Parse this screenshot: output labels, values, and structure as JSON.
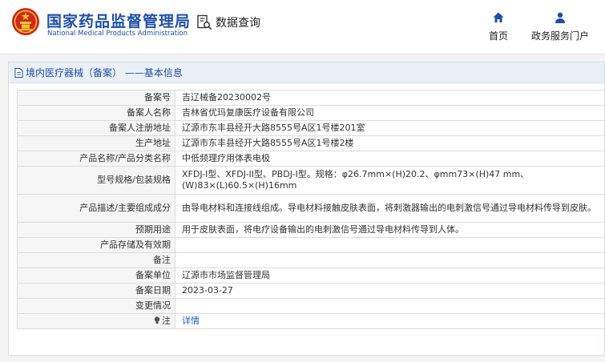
{
  "header": {
    "brand_cn": "国家药品监督管理局",
    "brand_en": "National Medical Products Administration",
    "query_label": "数据查询",
    "nav": [
      {
        "label": "首页",
        "icon": "home-icon"
      },
      {
        "label": "政务服务门户",
        "icon": "user-icon"
      }
    ]
  },
  "panel": {
    "title": "境内医疗器械（备案） ——基本信息"
  },
  "rows": [
    {
      "key": "备案号",
      "value": "吉辽械备20230002号"
    },
    {
      "key": "备案人名称",
      "value": "吉林省优玛复康医疗设备有限公司"
    },
    {
      "key": "备案人注册地址",
      "value": "辽源市东丰县经开大路8555号A区1号楼201室"
    },
    {
      "key": "生产地址",
      "value": "辽源市东丰县经开大路8555号A区1号楼2楼"
    },
    {
      "key": "产品名称/产品分类名称",
      "value": "中低频理疗用体表电极"
    },
    {
      "key": "型号规格/包装规格",
      "value": "XFDJ-I型、XFDJ-II型、PBDJ-I型。规格：φ26.7mm×(H)20.2、φmm73×(H)47 mm、(W)83×(L)60.5×(H)16mm"
    },
    {
      "key": "产品描述/主要组成成分",
      "value": "由导电材料和连接线组成。导电材料接触皮肤表面，将刺激器输出的电刺激信号通过导电材料传导到皮肤。"
    },
    {
      "key": "预期用途",
      "value": "用于皮肤表面，将电疗设备输出的电刺激信号通过导电材料传导到人体。"
    },
    {
      "key": "产品存储及有效期",
      "value": ""
    },
    {
      "key": "备注",
      "value": ""
    },
    {
      "key": "备案单位",
      "value": "辽源市市场监督管理局"
    },
    {
      "key": "备案日期",
      "value": "2023-03-27"
    },
    {
      "key": "变更情况",
      "value": ""
    },
    {
      "key": "注",
      "value": "详情"
    }
  ],
  "colors": {
    "brand_blue": "#1f4fa8",
    "emblem_red": "#d0281e",
    "emblem_gold": "#f2c230",
    "link_blue": "#1f5fbf"
  }
}
